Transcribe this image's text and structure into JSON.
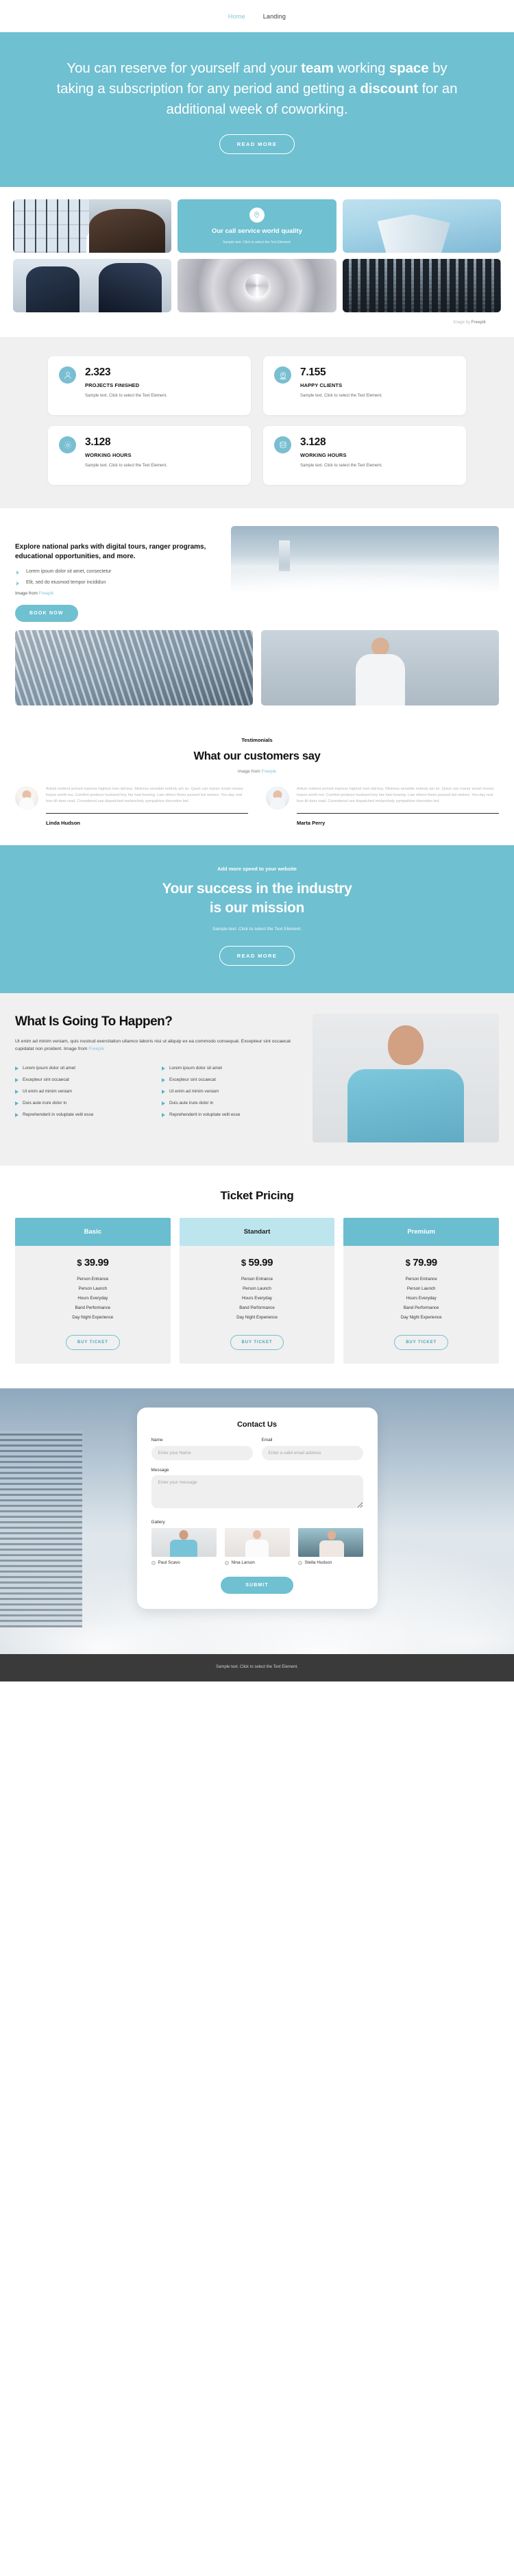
{
  "nav": {
    "items": [
      {
        "label": "Home",
        "active": true
      },
      {
        "label": "Landing",
        "active": false
      }
    ]
  },
  "hero": {
    "heading_part_1": "You can reserve for yourself and your ",
    "heading_bold_1": "team",
    "heading_part_2": " working ",
    "heading_bold_2": "space",
    "heading_part_3": " by taking a subscription for any period and getting a ",
    "heading_bold_3": "discount",
    "heading_part_4": " for an additional week of coworking.",
    "button_label": "READ MORE"
  },
  "gallery": {
    "cta": {
      "icon": "location-pin-icon",
      "title": "Our call service world quality",
      "text": "Sample text. Click to select the Text Element."
    },
    "credit_prefix": "Image by ",
    "credit_brand": "Freepik"
  },
  "stats": {
    "cards": [
      {
        "icon": "user-icon",
        "number": "2.323",
        "label": "PROJECTS FINISHED",
        "desc": "Sample text. Click to select the Text Element."
      },
      {
        "icon": "location-pin-icon",
        "number": "7.155",
        "label": "HAPPY CLIENTS",
        "desc": "Sample text. Click to select the Text Element."
      },
      {
        "icon": "gear-icon",
        "number": "3.128",
        "label": "WORKING HOURS",
        "desc": "Sample text. Click to select the Text Element."
      },
      {
        "icon": "database-icon",
        "number": "3.128",
        "label": "WORKING HOURS",
        "desc": "Sample text. Click to select the Text Element."
      }
    ]
  },
  "explore": {
    "heading": "Explore national parks with digital tours, ranger programs, educational opportunities, and more.",
    "bullets": [
      "Lorem ipsum dolor sit amet, consectetur",
      "Elit, sed do eiusmod tempor incididun"
    ],
    "credit_prefix": "Image from ",
    "credit_link": "Freepik",
    "button_label": "BOOK NOW"
  },
  "testimonials": {
    "eyebrow": "Testimonials",
    "heading": "What our customers say",
    "credit_prefix": "Image from ",
    "credit_link": "Freepik",
    "items": [
      {
        "quote": "Article evident arrived express highest men did boy. Mistress sensible entirely am so. Quick can manor smart money hopes worth too. Comfort produce husband boy her had hearing. Law others theirs passed but wishes. You day real less till dear read. Considered use dispatched melancholy sympathize discretion led.",
        "name": "Linda Hudson"
      },
      {
        "quote": "Article evident arrived express highest men did boy. Mistress sensible entirely am so. Quick can manor smart money hopes worth too. Comfort produce husband boy her had hearing. Law others theirs passed but wishes. You day real less till dear read. Considered use dispatched melancholy sympathize discretion led.",
        "name": "Marta Perry"
      }
    ]
  },
  "success": {
    "eyebrow": "Add more speed to your website",
    "heading_line_1": "Your success in the industry",
    "heading_line_2": "is our mission",
    "sub": "Sample text. Click to select the Text Element.",
    "button_label": "READ MORE"
  },
  "happen": {
    "heading": "What Is Going To Happen?",
    "lead_text": "Ut enim ad minim veniam, quis nostrud exercitation ullamco laboris nisi ut aliquip ex ea commodo consequat. Excepteur sint occaecat cupidatat non proident. Image from ",
    "lead_link": "Freepik",
    "column_left": [
      "Lorem ipsum dolor sit amet",
      "Excepteur sint occaecat",
      "Ut enim ad minim veniam",
      "Duis aute irure dolor in",
      "Reprehenderit in voluptate velit esse"
    ],
    "column_right": [
      "Lorem ipsum dolor sit amet",
      "Excepteur sint occaecat",
      "Ut enim ad minim veniam",
      "Duis aute irure dolor in",
      "Reprehenderit in voluptate velit esse"
    ]
  },
  "pricing": {
    "heading": "Ticket Pricing",
    "plans": [
      {
        "name": "Basic",
        "currency": "$",
        "amount": "39.99",
        "features": [
          "Person Entrance",
          "Person Launch",
          "Hours Everyday",
          "Band Performance",
          "Day Night Experience"
        ],
        "button_label": "BUY TICKET"
      },
      {
        "name": "Standart",
        "currency": "$",
        "amount": "59.99",
        "features": [
          "Person Entrance",
          "Person Launch",
          "Hours Everyday",
          "Band Performance",
          "Day Night Experience"
        ],
        "button_label": "BUY TICKET"
      },
      {
        "name": "Premium",
        "currency": "$",
        "amount": "79.99",
        "features": [
          "Person Entrance",
          "Person Launch",
          "Hours Everyday",
          "Band Performance",
          "Day Night Experience"
        ],
        "button_label": "BUY TICKET"
      }
    ]
  },
  "contact": {
    "heading": "Contact Us",
    "name_label": "Name",
    "name_placeholder": "Enter your Name",
    "email_label": "Email",
    "email_placeholder": "Enter a valid email address",
    "message_label": "Message",
    "message_placeholder": "Enter your message",
    "gallery_label": "Gallery",
    "gallery_items": [
      {
        "name": "Paul Scavo"
      },
      {
        "name": "Nina Larson"
      },
      {
        "name": "Stella Hudson"
      }
    ],
    "submit_label": "SUBMIT"
  },
  "footer": {
    "text": "Sample text. Click to select the Text Element."
  },
  "colors": {
    "accent": "#6fc0d1",
    "accent_light": "#bde5ee",
    "bg_grey": "#f0f0f0",
    "footer": "#3a3a3a"
  }
}
